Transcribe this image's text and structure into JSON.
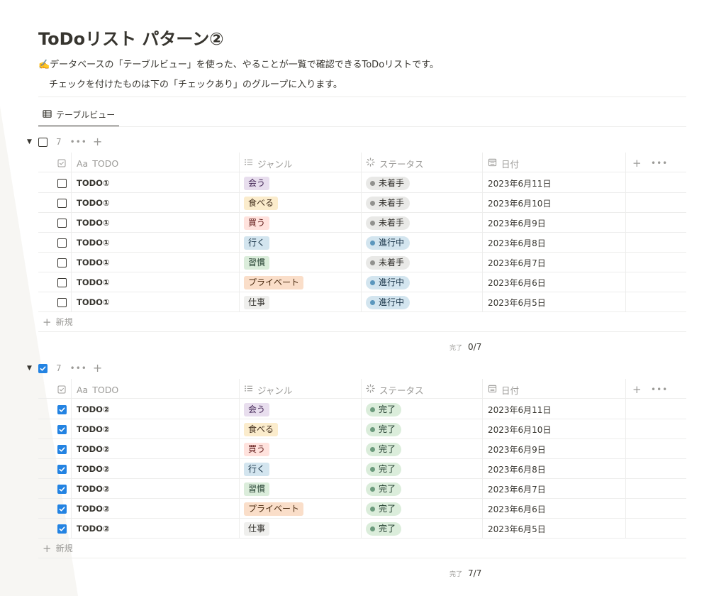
{
  "page": {
    "title": "ToDoリスト パターン②",
    "description_line1": "✍️データベースの「テーブルビュー」を使った、やることが一覧で確認できるToDoリストです。",
    "description_line2": "チェックを付けたものは下の「チェックあり」のグループに入ります。"
  },
  "view_tab": {
    "label": "テーブルビュー",
    "icon": "table-icon"
  },
  "columns": {
    "checkbox_icon": "checkbox-icon",
    "todo_prefix": "Aa",
    "todo": "TODO",
    "genre": "ジャンル",
    "status": "ステータス",
    "date": "日付"
  },
  "colors": {
    "accent": "#2383e2",
    "genre_tags": {
      "会う": {
        "bg": "#e8deee",
        "fg": "#412454"
      },
      "食べる": {
        "bg": "#fbeccc",
        "fg": "#402c1b"
      },
      "買う": {
        "bg": "#ffe2dd",
        "fg": "#5d1715"
      },
      "行く": {
        "bg": "#d3e5ef",
        "fg": "#183347"
      },
      "習慣": {
        "bg": "#dbeddb",
        "fg": "#1c3829"
      },
      "プライベート": {
        "bg": "#fadec9",
        "fg": "#49290e"
      },
      "仕事": {
        "bg": "#efefed",
        "fg": "#32302c"
      }
    },
    "status": {
      "未着手": {
        "bg": "#e9e9e7",
        "dot": "#91918e",
        "fg": "#32302c"
      },
      "進行中": {
        "bg": "#d3e5ef",
        "dot": "#5b97bd",
        "fg": "#183347"
      },
      "完了": {
        "bg": "#dbeddb",
        "dot": "#6c9b7d",
        "fg": "#1c3829"
      }
    }
  },
  "groups": [
    {
      "checked": false,
      "count": "7",
      "new_label": "新規",
      "summary_label": "完了",
      "summary_value": "0/7",
      "rows": [
        {
          "checked": false,
          "todo": "TODO①",
          "genre": "会う",
          "status": "未着手",
          "date": "2023年6月11日"
        },
        {
          "checked": false,
          "todo": "TODO①",
          "genre": "食べる",
          "status": "未着手",
          "date": "2023年6月10日"
        },
        {
          "checked": false,
          "todo": "TODO①",
          "genre": "買う",
          "status": "未着手",
          "date": "2023年6月9日"
        },
        {
          "checked": false,
          "todo": "TODO①",
          "genre": "行く",
          "status": "進行中",
          "date": "2023年6月8日"
        },
        {
          "checked": false,
          "todo": "TODO①",
          "genre": "習慣",
          "status": "未着手",
          "date": "2023年6月7日"
        },
        {
          "checked": false,
          "todo": "TODO①",
          "genre": "プライベート",
          "status": "進行中",
          "date": "2023年6月6日"
        },
        {
          "checked": false,
          "todo": "TODO①",
          "genre": "仕事",
          "status": "進行中",
          "date": "2023年6月5日"
        }
      ]
    },
    {
      "checked": true,
      "count": "7",
      "new_label": "新規",
      "summary_label": "完了",
      "summary_value": "7/7",
      "rows": [
        {
          "checked": true,
          "todo": "TODO②",
          "genre": "会う",
          "status": "完了",
          "date": "2023年6月11日"
        },
        {
          "checked": true,
          "todo": "TODO②",
          "genre": "食べる",
          "status": "完了",
          "date": "2023年6月10日"
        },
        {
          "checked": true,
          "todo": "TODO②",
          "genre": "買う",
          "status": "完了",
          "date": "2023年6月9日"
        },
        {
          "checked": true,
          "todo": "TODO②",
          "genre": "行く",
          "status": "完了",
          "date": "2023年6月8日"
        },
        {
          "checked": true,
          "todo": "TODO②",
          "genre": "習慣",
          "status": "完了",
          "date": "2023年6月7日"
        },
        {
          "checked": true,
          "todo": "TODO②",
          "genre": "プライベート",
          "status": "完了",
          "date": "2023年6月6日"
        },
        {
          "checked": true,
          "todo": "TODO②",
          "genre": "仕事",
          "status": "完了",
          "date": "2023年6月5日"
        }
      ]
    }
  ]
}
